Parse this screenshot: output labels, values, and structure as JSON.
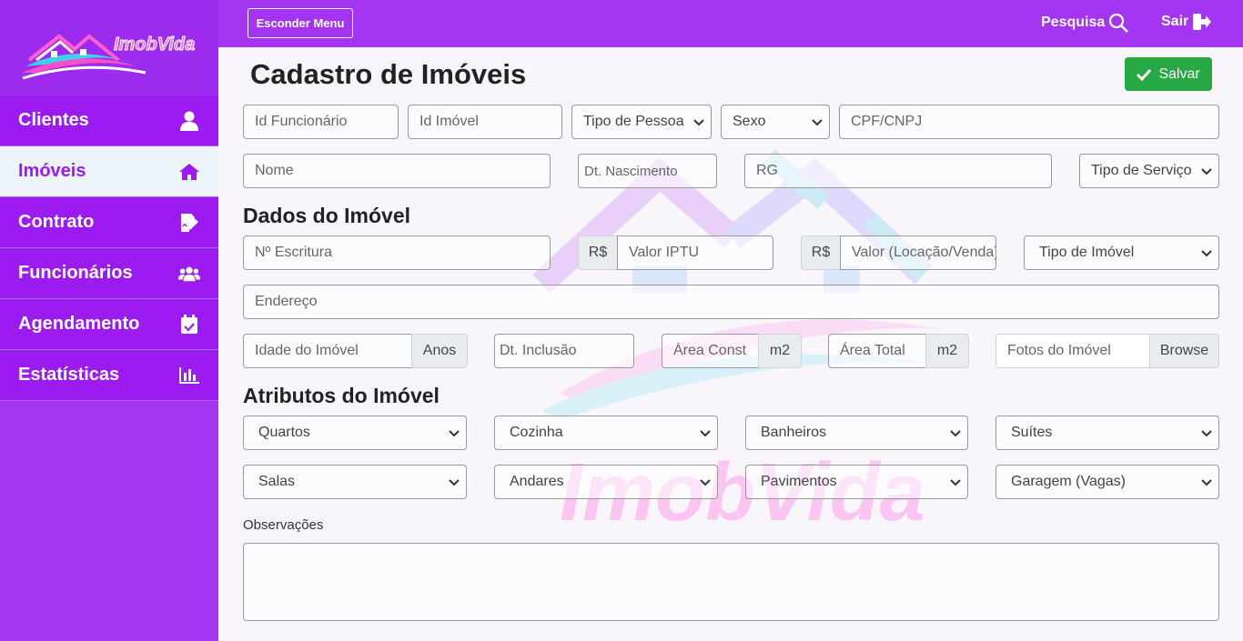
{
  "brand": {
    "logo_text": "ImobVida"
  },
  "topbar": {
    "hide_menu_label": "Esconder Menu",
    "search_label": "Pesquisa",
    "exit_label": "Sair"
  },
  "sidebar": {
    "items": [
      {
        "label": "Clientes",
        "icon": "user-icon"
      },
      {
        "label": "Imóveis",
        "icon": "home-icon",
        "active": true
      },
      {
        "label": "Contrato",
        "icon": "signature-icon"
      },
      {
        "label": "Funcionários",
        "icon": "users-icon"
      },
      {
        "label": "Agendamento",
        "icon": "calendar-check-icon"
      },
      {
        "label": "Estatísticas",
        "icon": "chart-bar-icon"
      }
    ]
  },
  "page": {
    "title": "Cadastro de Imóveis",
    "save_label": "Salvar"
  },
  "form": {
    "id_funcionario": "Id Funcionário",
    "id_imovel": "Id Imóvel",
    "tipo_pessoa": "Tipo de Pessoa",
    "sexo": "Sexo",
    "cpf_cnpj": "CPF/CNPJ",
    "nome": "Nome",
    "dt_nascimento": "Dt. Nascimento",
    "rg": "RG",
    "tipo_servico": "Tipo de Serviço"
  },
  "dados": {
    "title": "Dados do Imóvel",
    "escritura": "Nº Escritura",
    "currency": "R$",
    "valor_iptu": "Valor IPTU",
    "valor_locacao": "Valor (Locação/Venda)",
    "tipo_imovel": "Tipo de Imóvel",
    "endereco": "Endereço",
    "idade": "Idade do Imóvel",
    "anos": "Anos",
    "dt_inclusao": "Dt. Inclusão",
    "area_construida": "Área Construída",
    "m2": "m2",
    "area_total": "Área Total",
    "fotos": "Fotos do Imóvel",
    "browse": "Browse"
  },
  "atributos": {
    "title": "Atributos do Imóvel",
    "quartos": "Quartos",
    "cozinha": "Cozinha",
    "banheiros": "Banheiros",
    "suites": "Suítes",
    "salas": "Salas",
    "andares": "Andares",
    "pavimentos": "Pavimentos",
    "garagem": "Garagem (Vagas)"
  },
  "observacoes": {
    "label": "Observações",
    "value": ""
  },
  "colors": {
    "sidebar": "#9b1bf0",
    "topbar": "#a335f0",
    "save": "#28a745",
    "active_bg": "#eef4fb"
  }
}
